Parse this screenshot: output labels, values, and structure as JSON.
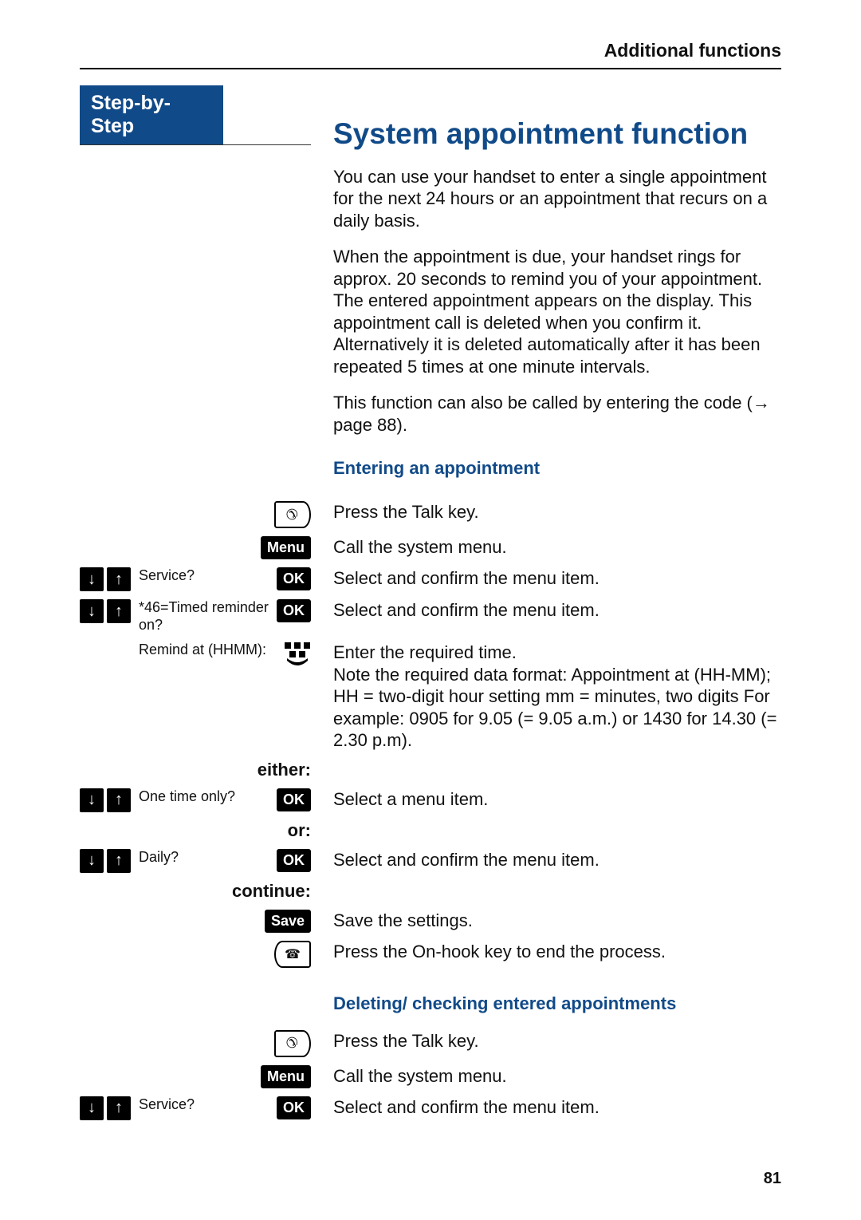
{
  "header": {
    "section": "Additional functions"
  },
  "sidebar": {
    "label": "Step-by-Step"
  },
  "title": "System appointment function",
  "paragraphs": {
    "p1": "You can use your handset to enter a single appointment for the next 24 hours or an appointment that recurs on a daily basis.",
    "p2": "When the appointment is due, your handset rings for approx. 20 seconds to remind you of your appointment. The entered appointment appears on the display. This appointment call is deleted when you confirm it. Alternatively it is deleted automatically after it has been repeated 5 times at one minute intervals.",
    "p3_a": "This function can also be called by entering the code (",
    "p3_arrow": "→",
    "p3_b": " page 88)."
  },
  "sections": {
    "entering": "Entering an appointment",
    "deleting": "Deleting/ checking entered appointments"
  },
  "controls": {
    "menu": "Menu",
    "ok": "OK",
    "save": "Save"
  },
  "labels": {
    "either": "either:",
    "or": "or:",
    "continue": "continue:"
  },
  "steps_enter": [
    {
      "kind": "talk",
      "desc": "Press the Talk key."
    },
    {
      "kind": "menu",
      "desc": "Call the system menu."
    },
    {
      "kind": "nav_ok",
      "text": "Service?",
      "desc": "Select and confirm the menu item."
    },
    {
      "kind": "nav_ok",
      "text": "*46=Timed reminder on?",
      "desc": "Select and confirm the menu item."
    },
    {
      "kind": "entry",
      "text": "Remind at (HHMM):",
      "desc": "Enter the required time.\nNote the required data format: Appointment at (HH-MM); HH = two-digit hour setting mm = minutes, two digits For example: 0905 for 9.05 (= 9.05 a.m.) or 1430 for 14.30 (= 2.30 p.m)."
    }
  ],
  "steps_either": {
    "text": "One time only?",
    "desc": "Select a menu item."
  },
  "steps_or": {
    "text": "Daily?",
    "desc": "Select and confirm the menu item."
  },
  "steps_continue": [
    {
      "kind": "save",
      "desc": "Save the settings."
    },
    {
      "kind": "onhook",
      "desc": "Press the On-hook key to end the process."
    }
  ],
  "steps_delete": [
    {
      "kind": "talk",
      "desc": "Press the Talk key."
    },
    {
      "kind": "menu",
      "desc": "Call the system menu."
    },
    {
      "kind": "nav_ok",
      "text": "Service?",
      "desc": "Select and confirm the menu item."
    }
  ],
  "page_number": "81"
}
